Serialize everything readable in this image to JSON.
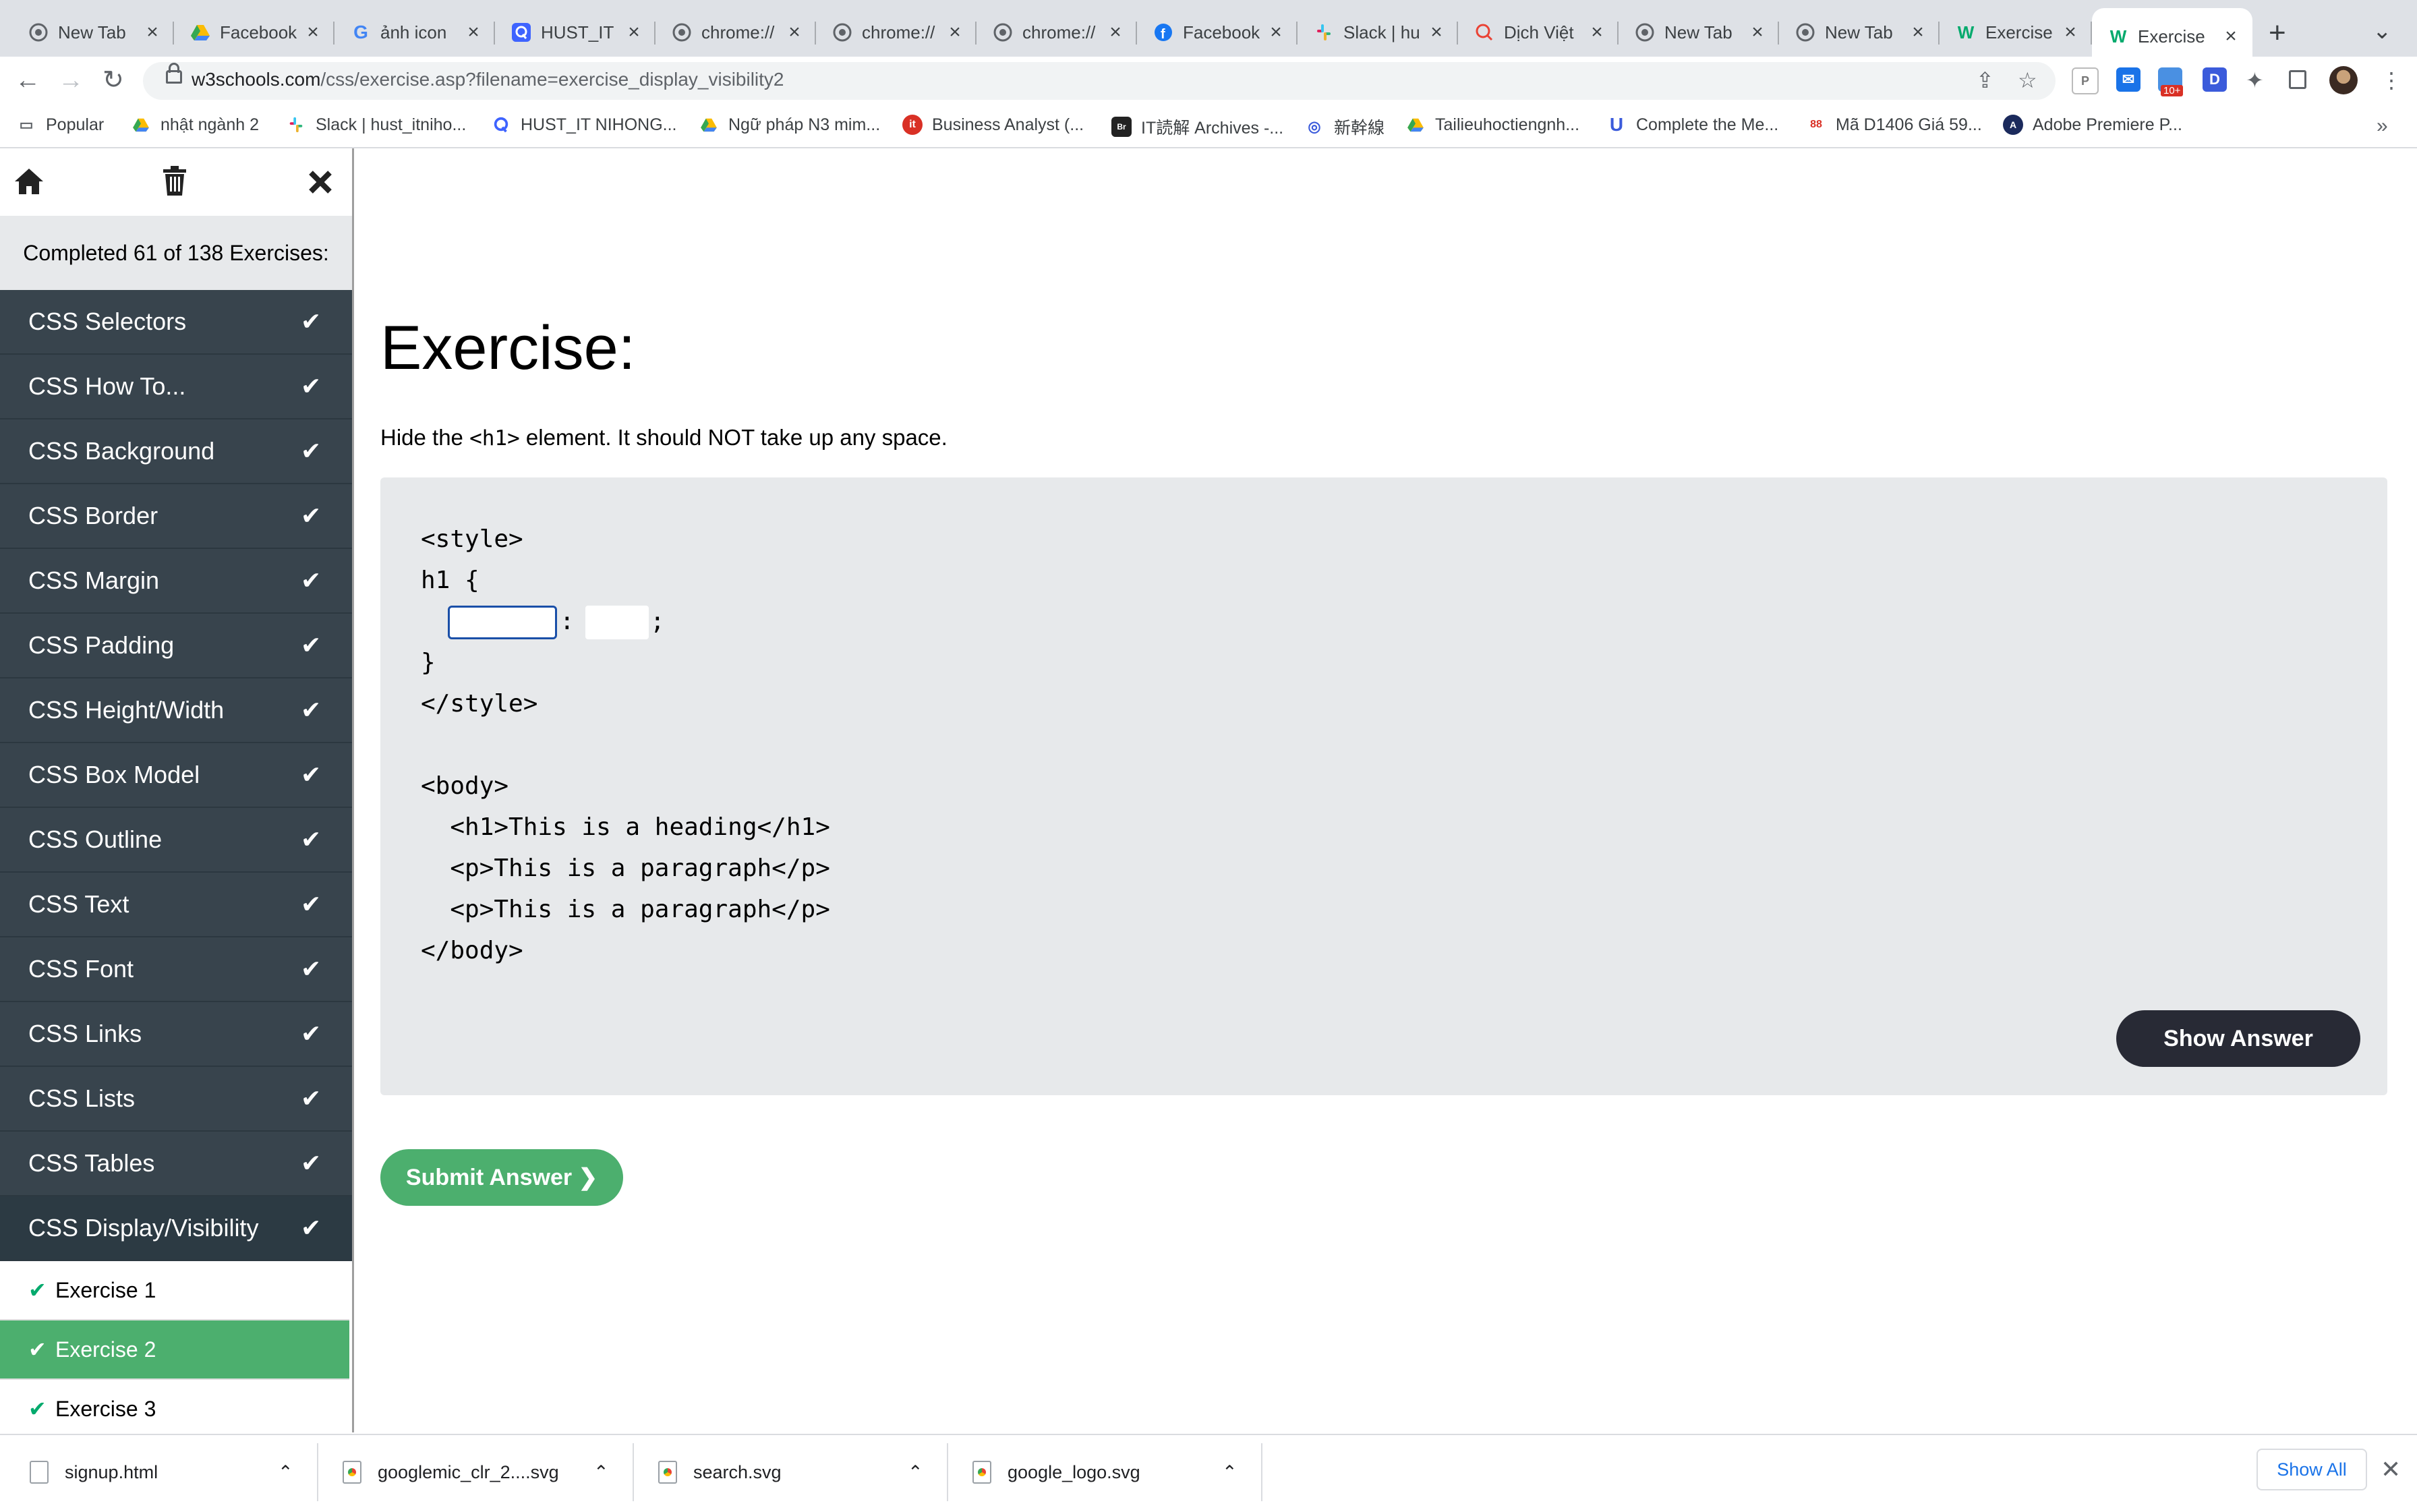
{
  "browser": {
    "tabs": [
      {
        "title": "New Tab",
        "icon": "chrome-icon",
        "active": false
      },
      {
        "title": "Facebook",
        "icon": "google-drive-icon",
        "active": false
      },
      {
        "title": "ảnh icon",
        "icon": "google-icon",
        "active": false
      },
      {
        "title": "HUST_IT",
        "icon": "quora-icon",
        "active": false
      },
      {
        "title": "chrome://",
        "icon": "chrome-icon",
        "active": false
      },
      {
        "title": "chrome://",
        "icon": "chrome-icon",
        "active": false
      },
      {
        "title": "chrome://",
        "icon": "chrome-icon",
        "active": false
      },
      {
        "title": "Facebook",
        "icon": "facebook-icon",
        "active": false
      },
      {
        "title": "Slack | hu",
        "icon": "slack-icon",
        "active": false
      },
      {
        "title": "Dịch Việt",
        "icon": "translate-icon",
        "active": false
      },
      {
        "title": "New Tab",
        "icon": "chrome-icon",
        "active": false
      },
      {
        "title": "New Tab",
        "icon": "chrome-icon",
        "active": false
      },
      {
        "title": "Exercise",
        "icon": "w3schools-icon",
        "active": false
      },
      {
        "title": "Exercise",
        "icon": "w3schools-icon",
        "active": true
      }
    ],
    "url_domain": "w3schools.com",
    "url_path": "/css/exercise.asp?filename=exercise_display_visibility2",
    "extension_badge": "10+",
    "bookmarks": [
      {
        "label": "Popular",
        "icon": "folder-icon"
      },
      {
        "label": "nhật ngành 2",
        "icon": "google-drive-icon"
      },
      {
        "label": "Slack | hust_itniho...",
        "icon": "slack-icon"
      },
      {
        "label": "HUST_IT NIHONG...",
        "icon": "quora-icon"
      },
      {
        "label": "Ngữ pháp N3 mim...",
        "icon": "google-drive-icon"
      },
      {
        "label": "Business Analyst (...",
        "icon": "it-icon"
      },
      {
        "label": "IT読解 Archives -...",
        "icon": "brse-icon"
      },
      {
        "label": "新幹線",
        "icon": "search-engine-icon"
      },
      {
        "label": "Tailieuhoctiengnh...",
        "icon": "google-drive-icon"
      },
      {
        "label": "Complete the Me...",
        "icon": "udacity-icon"
      },
      {
        "label": "Mã D1406 Giá 59...",
        "icon": "shop-icon"
      },
      {
        "label": "Adobe Premiere P...",
        "icon": "adobe-icon"
      }
    ]
  },
  "sidebar": {
    "progress_text": "Completed 61 of 138 Exercises:",
    "categories": [
      "CSS Selectors",
      "CSS How To...",
      "CSS Background",
      "CSS Border",
      "CSS Margin",
      "CSS Padding",
      "CSS Height/Width",
      "CSS Box Model",
      "CSS Outline",
      "CSS Text",
      "CSS Font",
      "CSS Links",
      "CSS Lists",
      "CSS Tables",
      "CSS Display/Visibility"
    ],
    "exercises": [
      {
        "label": "Exercise 1",
        "active": false
      },
      {
        "label": "Exercise 2",
        "active": true
      },
      {
        "label": "Exercise 3",
        "active": false
      }
    ]
  },
  "main": {
    "title": "Exercise:",
    "instruction_pre": "Hide the ",
    "instruction_code": "<h1>",
    "instruction_post": " element. It should NOT take up any space.",
    "code": {
      "line_style_open": "<style>",
      "line_selector": "h1 {",
      "colon": ":",
      "semicolon": ";",
      "line_brace_close": "}",
      "line_style_close": "</style>",
      "line_body_open": "<body>",
      "line_h1": "  <h1>This is a heading</h1>",
      "line_p1": "  <p>This is a paragraph</p>",
      "line_p2": "  <p>This is a paragraph</p>",
      "line_body_close": "</body>"
    },
    "input_property_value": "",
    "input_value_value": "",
    "show_answer_label": "Show Answer",
    "submit_label": "Submit Answer ❯"
  },
  "downloads": {
    "items": [
      "signup.html",
      "googlemic_clr_2....svg",
      "search.svg",
      "google_logo.svg"
    ],
    "show_all_label": "Show All"
  },
  "colors": {
    "sidebar_category": "#38444d",
    "active_exercise": "#4caf6e",
    "check_green": "#04aa6d",
    "show_answer_button": "#282a35",
    "submit_button": "#4caf6e",
    "code_box": "#e7e9eb"
  }
}
